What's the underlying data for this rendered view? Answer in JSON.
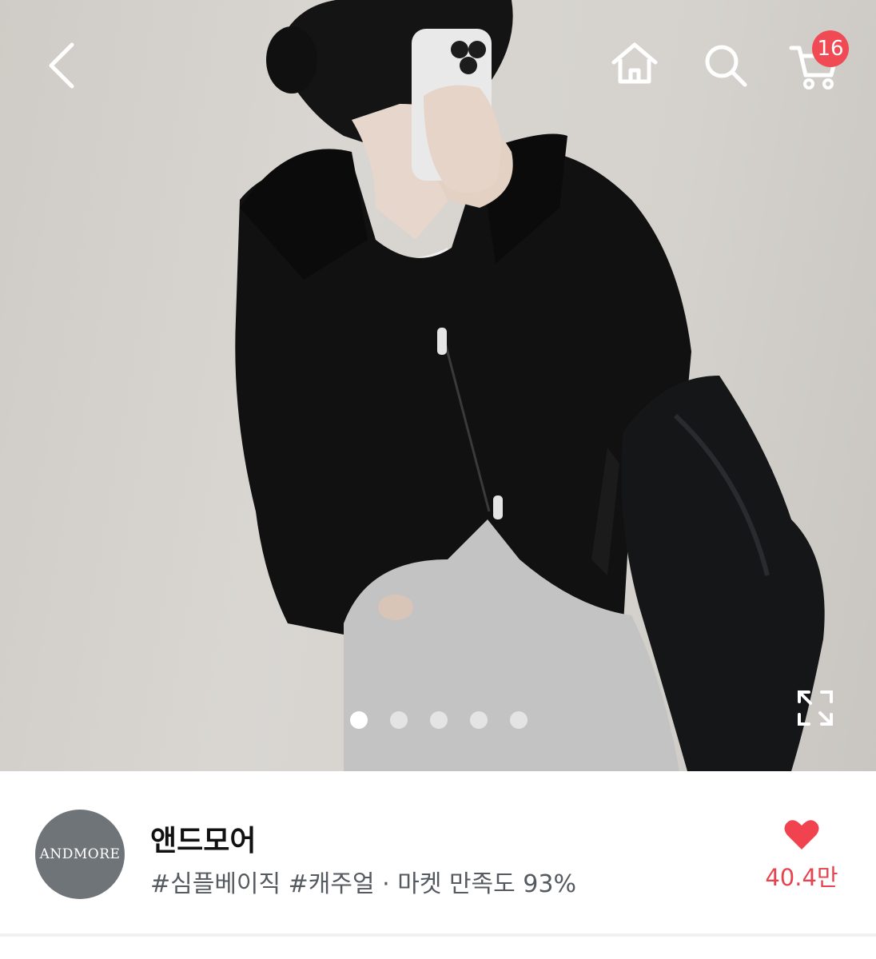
{
  "header": {
    "back_icon": "chevron-left-icon",
    "home_icon": "home-icon",
    "search_icon": "search-icon",
    "cart_icon": "cart-icon",
    "cart_badge_count": "16",
    "badge_color": "#f04a55"
  },
  "gallery": {
    "total_images": 5,
    "active_index": 0,
    "expand_icon": "expand-icon"
  },
  "shop": {
    "logo_text": "ANDMORE",
    "name": "앤드모어",
    "tags_line": "#심플베이직 #캐주얼 · 마켓 만족도 93%",
    "like_icon": "heart-icon",
    "like_count": "40.4만",
    "accent_color": "#e6444f"
  }
}
